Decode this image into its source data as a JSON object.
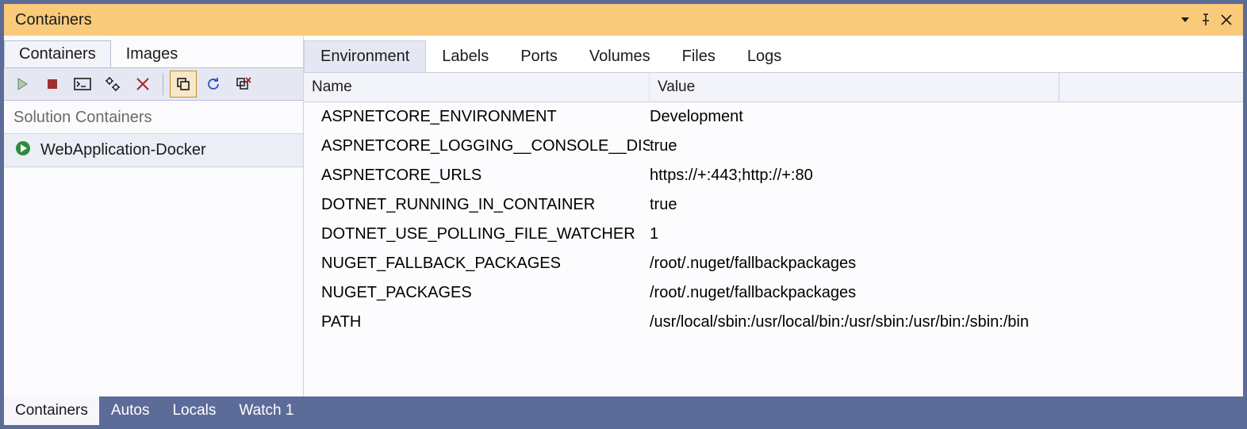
{
  "window": {
    "title": "Containers"
  },
  "left": {
    "tabs": [
      {
        "label": "Containers",
        "active": true
      },
      {
        "label": "Images",
        "active": false
      }
    ],
    "section_label": "Solution Containers",
    "items": [
      {
        "label": "WebApplication-Docker"
      }
    ]
  },
  "toolbar": {
    "icons": [
      "play-icon",
      "stop-icon",
      "terminal-icon",
      "settings-icon",
      "delete-icon",
      "|",
      "copy-icon",
      "refresh-icon",
      "prune-icon"
    ]
  },
  "right": {
    "tabs": [
      {
        "label": "Environment",
        "active": true
      },
      {
        "label": "Labels"
      },
      {
        "label": "Ports"
      },
      {
        "label": "Volumes"
      },
      {
        "label": "Files"
      },
      {
        "label": "Logs"
      }
    ],
    "columns": {
      "name": "Name",
      "value": "Value"
    },
    "rows": [
      {
        "name": "ASPNETCORE_ENVIRONMENT",
        "value": "Development"
      },
      {
        "name": "ASPNETCORE_LOGGING__CONSOLE__DISA…",
        "value": "true"
      },
      {
        "name": "ASPNETCORE_URLS",
        "value": "https://+:443;http://+:80"
      },
      {
        "name": "DOTNET_RUNNING_IN_CONTAINER",
        "value": "true"
      },
      {
        "name": "DOTNET_USE_POLLING_FILE_WATCHER",
        "value": "1"
      },
      {
        "name": "NUGET_FALLBACK_PACKAGES",
        "value": "/root/.nuget/fallbackpackages"
      },
      {
        "name": "NUGET_PACKAGES",
        "value": "/root/.nuget/fallbackpackages"
      },
      {
        "name": "PATH",
        "value": "/usr/local/sbin:/usr/local/bin:/usr/sbin:/usr/bin:/sbin:/bin"
      }
    ]
  },
  "bottom": {
    "tabs": [
      {
        "label": "Containers",
        "active": true
      },
      {
        "label": "Autos"
      },
      {
        "label": "Locals"
      },
      {
        "label": "Watch 1"
      }
    ]
  }
}
